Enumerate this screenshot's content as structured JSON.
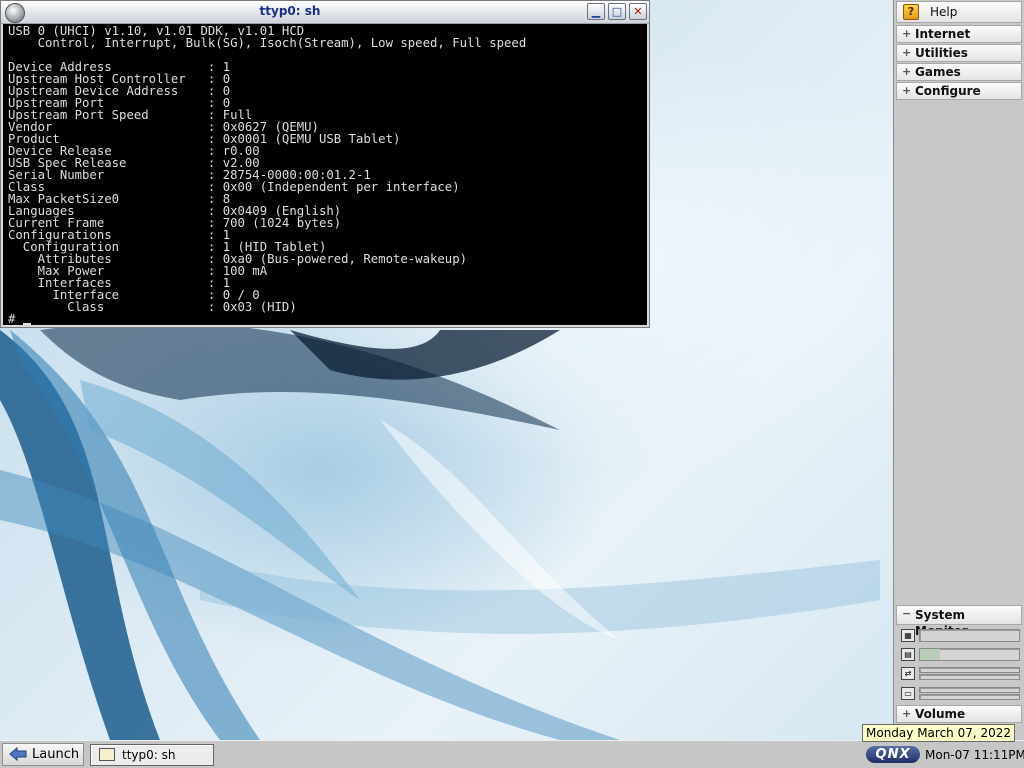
{
  "terminal": {
    "title": "ttyp0: sh",
    "lines": [
      "USB 0 (UHCI) v1.10, v1.01 DDK, v1.01 HCD",
      "    Control, Interrupt, Bulk(SG), Isoch(Stream), Low speed, Full speed",
      "",
      "Device Address             : 1",
      "Upstream Host Controller   : 0",
      "Upstream Device Address    : 0",
      "Upstream Port              : 0",
      "Upstream Port Speed        : Full",
      "Vendor                     : 0x0627 (QEMU)",
      "Product                    : 0x0001 (QEMU USB Tablet)",
      "Device Release             : r0.00",
      "USB Spec Release           : v2.00",
      "Serial Number              : 28754-0000:00:01.2-1",
      "Class                      : 0x00 (Independent per interface)",
      "Max PacketSize0            : 8",
      "Languages                  : 0x0409 (English)",
      "Current Frame              : 700 (1024 bytes)",
      "Configurations             : 1",
      "  Configuration            : 1 (HID Tablet)",
      "    Attributes             : 0xa0 (Bus-powered, Remote-wakeup)",
      "    Max Power              : 100 mA",
      "    Interfaces             : 1",
      "      Interface            : 0 / 0",
      "        Class              : 0x03 (HID)"
    ],
    "prompt": "# "
  },
  "shelf": {
    "help": "Help",
    "groups": [
      "Internet",
      "Utilities",
      "Games",
      "Configure"
    ],
    "system_monitor": {
      "title": "System Monitor",
      "meters": [
        {
          "icon": "cpu-icon",
          "fraction": 0.0
        },
        {
          "icon": "memory-icon",
          "fraction": 0.2
        },
        {
          "icon": "network-icon",
          "fraction": 0.0
        },
        {
          "icon": "disk-icon",
          "fraction": 0.0
        }
      ]
    },
    "volume": "Volume",
    "colors": {
      "meter_fill": "#b8cdb8"
    }
  },
  "taskbar": {
    "launch": "Launch",
    "tasks": [
      {
        "label": "ttyp0: sh"
      }
    ],
    "logo": "QNX",
    "clock": "Mon-07  11:11PM",
    "tooltip": "Monday March 07, 2022"
  }
}
